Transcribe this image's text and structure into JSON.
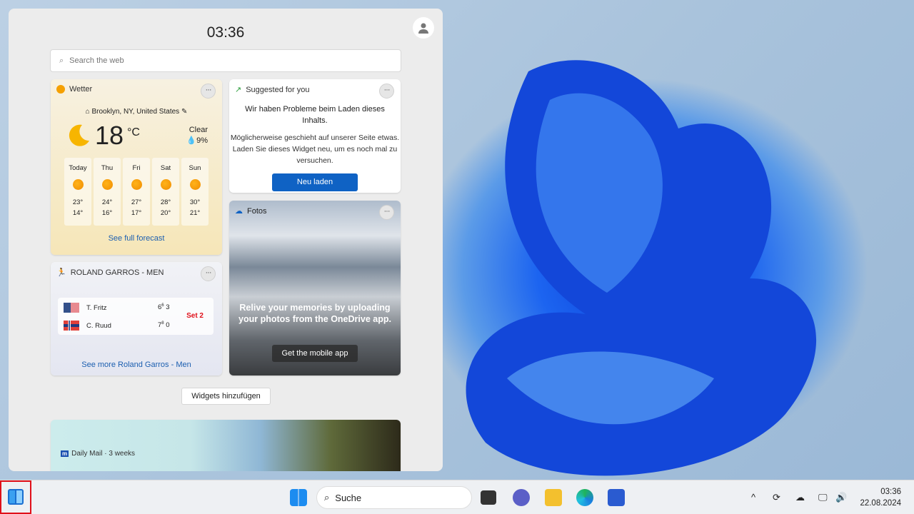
{
  "panel": {
    "time": "03:36",
    "search_placeholder": "Search the web"
  },
  "weather": {
    "title": "Wetter",
    "location": "Brooklyn, NY, United States",
    "temp": "18",
    "unit": "°C",
    "condition": "Clear",
    "precip": "9%",
    "days": [
      {
        "d": "Today",
        "hi": "23°",
        "lo": "14°"
      },
      {
        "d": "Thu",
        "hi": "24°",
        "lo": "16°"
      },
      {
        "d": "Fri",
        "hi": "27°",
        "lo": "17°"
      },
      {
        "d": "Sat",
        "hi": "28°",
        "lo": "20°"
      },
      {
        "d": "Sun",
        "hi": "30°",
        "lo": "21°"
      }
    ],
    "link": "See full forecast"
  },
  "suggested": {
    "title": "Suggested for you",
    "heading": "Wir haben Probleme beim Laden dieses Inhalts.",
    "body": "Möglicherweise geschieht auf unserer Seite etwas. Laden Sie dieses Widget neu, um es noch mal zu versuchen.",
    "button": "Neu laden"
  },
  "fotos": {
    "title": "Fotos",
    "message": "Relive your memories by uploading your photos from the OneDrive app.",
    "button": "Get the mobile app"
  },
  "tennis": {
    "title": "ROLAND GARROS - MEN",
    "p1": "T. Fritz",
    "p1s1": "6",
    "p1t": "6",
    "p1s2": "3",
    "p2": "C. Ruud",
    "p2s1": "7",
    "p2t": "8",
    "p2s2": "0",
    "status": "Set 2",
    "status_color": "#e0101a",
    "link": "See more Roland Garros - Men"
  },
  "add_widgets": "Widgets hinzufügen",
  "news": {
    "source": "Daily Mail · 3 weeks"
  },
  "taskbar": {
    "search": "Suche",
    "time": "03:36",
    "date": "22.08.2024"
  }
}
